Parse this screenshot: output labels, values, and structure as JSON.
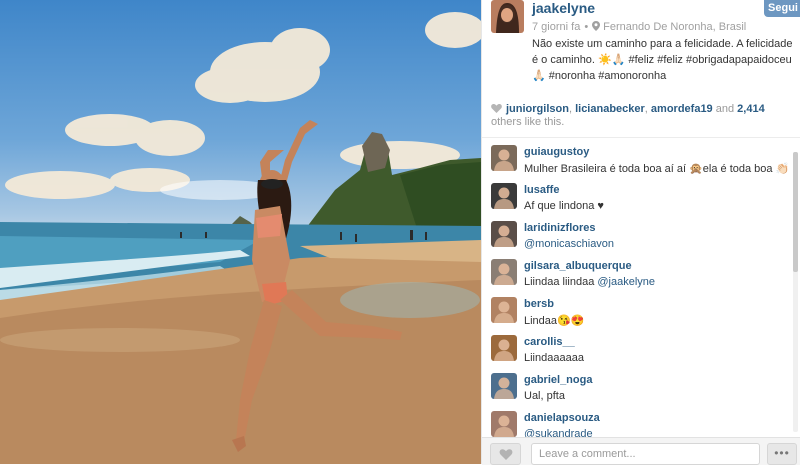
{
  "post": {
    "username": "jaakelyne",
    "follow_label": "Segui",
    "time_ago": "7 giorni fa",
    "location": "Fernando De Noronha, Brasil",
    "caption": "Não existe um caminho para a felicidade. A felicidade é o caminho. ☀️🙏🏻 #feliz #feliz #obrigadapapaidoceu 🙏🏻 #noronha #amonoronha"
  },
  "likes": {
    "users": [
      "juniorgilson",
      "licianabecker",
      "amordefa19"
    ],
    "and_label": "and",
    "count": "2,414",
    "suffix": "others like this."
  },
  "comments": [
    {
      "user": "guiaugustoy",
      "text": "Mulher Brasileira é toda boa aí aí 🙊ela é toda boa 👏🏻👏🏻",
      "mention": "",
      "avatar_color": "#7b6a5a"
    },
    {
      "user": "lusaffe",
      "text": "Af que lindona ♥",
      "mention": "",
      "avatar_color": "#3a3a3a"
    },
    {
      "user": "laridinizflores",
      "text": "",
      "mention": "@monicaschiavon",
      "avatar_color": "#5a4e48"
    },
    {
      "user": "gilsara_albuquerque",
      "text": "Liindaa liindaa ",
      "mention": "@jaakelyne",
      "avatar_color": "#8a7e74"
    },
    {
      "user": "bersb",
      "text": "Lindaa😘😍",
      "mention": "",
      "avatar_color": "#b18262"
    },
    {
      "user": "carollis__",
      "text": "Liindaaaaaa",
      "mention": "",
      "avatar_color": "#9c6a3c"
    },
    {
      "user": "gabriel_noga",
      "text": "Ual, pfta",
      "mention": "",
      "avatar_color": "#4d6f8e"
    },
    {
      "user": "danielapsouza",
      "text": "",
      "mention": "@sukandrade",
      "avatar_color": "#a07a6a"
    }
  ],
  "footer": {
    "comment_placeholder": "Leave a comment...",
    "more_label": "•••"
  },
  "icons": {
    "location": "map-pin-icon",
    "like": "heart-icon",
    "more": "ellipsis-icon"
  },
  "colors": {
    "username": "#2a5b83",
    "follow_button": "#6d97c1"
  }
}
